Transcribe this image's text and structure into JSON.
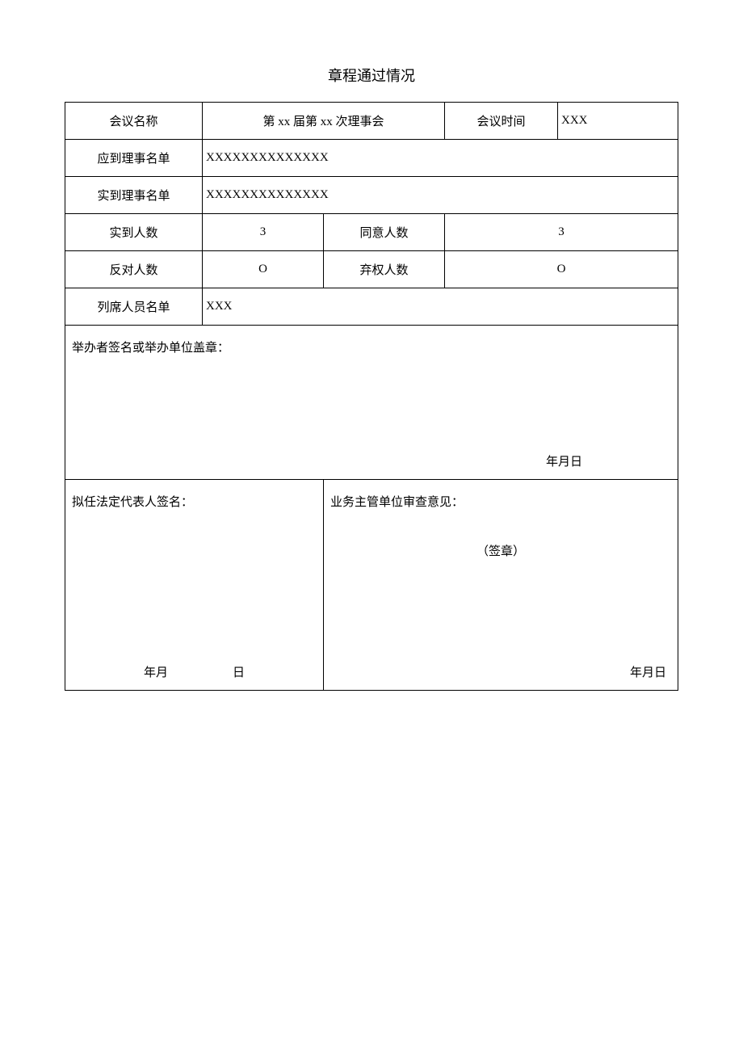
{
  "title": "章程通过情况",
  "labels": {
    "meeting_name": "会议名称",
    "meeting_time": "会议时间",
    "expected_list": "应到理事名单",
    "actual_list": "实到理事名单",
    "actual_count": "实到人数",
    "agree_count": "同意人数",
    "oppose_count": "反对人数",
    "abstain_count": "弃权人数",
    "attendee_list": "列席人员名单",
    "organizer_sig": "举办者签名或举办单位盖章：",
    "legal_rep_sig": "拟任法定代表人签名：",
    "supervisor_opinion": "业务主管单位审查意见：",
    "seal": "（签章）",
    "date_ymd": "年月日",
    "date_ym": "年月",
    "date_d": "日"
  },
  "values": {
    "meeting_name": "第 xx 届第 xx 次理事会",
    "meeting_time": "XXX",
    "expected_list": "XXXXXXXXXXXXXX",
    "actual_list": "XXXXXXXXXXXXXX",
    "actual_count": "3",
    "agree_count": "3",
    "oppose_count": "O",
    "abstain_count": "O",
    "attendee_list": "XXX"
  }
}
